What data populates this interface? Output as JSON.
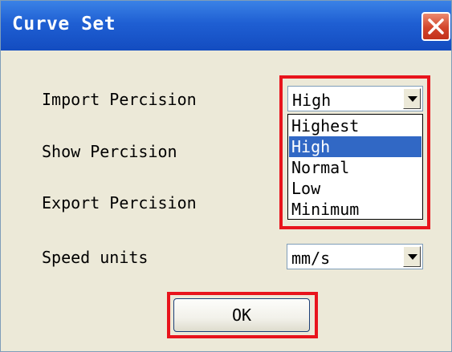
{
  "window": {
    "title": "Curve Set",
    "close_icon": "close-icon"
  },
  "fields": {
    "import_precision": {
      "label": "Import Percision",
      "value": "High",
      "dropdown_open": true
    },
    "show_precision": {
      "label": "Show Percision"
    },
    "export_precision": {
      "label": "Export Percision"
    },
    "speed_units": {
      "label": "Speed units",
      "value": "mm/s"
    }
  },
  "precision_options": [
    "Highest",
    "High",
    "Normal",
    "Low",
    "Minimum"
  ],
  "selected_option": "High",
  "ok_label": "OK",
  "colors": {
    "titlebar": "#1f5fd3",
    "window_bg": "#ece9d8",
    "selection": "#3168c5",
    "highlight": "#e8141c"
  }
}
